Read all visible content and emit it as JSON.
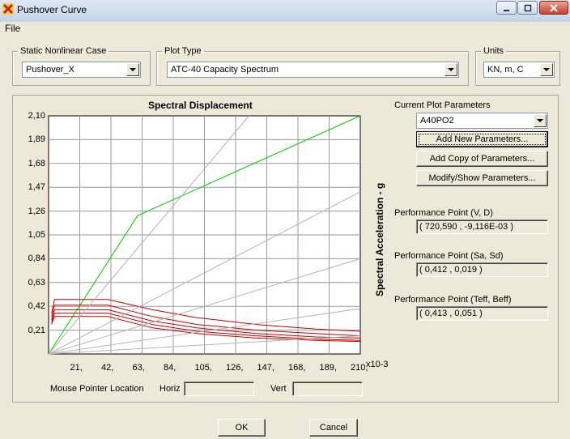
{
  "window": {
    "title": "Pushover Curve",
    "app_icon": "x-cross-icon",
    "buttons": {
      "minimize": "minimize-icon",
      "maximize": "maximize-icon",
      "close": "close-icon"
    }
  },
  "menu": {
    "file": "File"
  },
  "groups": {
    "case": {
      "label": "Static Nonlinear Case",
      "value": "Pushover_X"
    },
    "plot_type": {
      "label": "Plot Type",
      "value": "ATC-40 Capacity Spectrum"
    },
    "units": {
      "label": "Units",
      "value": "KN, m, C"
    }
  },
  "params": {
    "label": "Current Plot Parameters",
    "value": "A40PO2",
    "buttons": {
      "add_new": "Add New Parameters...",
      "add_copy": "Add Copy of Parameters...",
      "modify": "Modify/Show Parameters..."
    }
  },
  "performance": {
    "vd_label": "Performance Point (V, D)",
    "vd_value": "( 720,590 , -9,116E-03 )",
    "sasd_label": "Performance Point (Sa, Sd)",
    "sasd_value": "( 0,412 , 0,019 )",
    "teff_label": "Performance Point (Teff, Beff)",
    "teff_value": "( 0,413 , 0,051 )"
  },
  "mouse": {
    "label": "Mouse Pointer Location",
    "horiz_label": "Horiz",
    "horiz_value": "",
    "vert_label": "Vert",
    "vert_value": ""
  },
  "footer": {
    "ok": "OK",
    "cancel": "Cancel"
  },
  "chart_data": {
    "type": "line",
    "title": "Spectral Displacement",
    "ylabel": "Spectral Acceleration - g",
    "x_multiplier_label": "x10-3",
    "xlim": [
      0,
      210
    ],
    "ylim": [
      0,
      2.1
    ],
    "x_ticks": [
      "21,",
      "42,",
      "63,",
      "84,",
      "105,",
      "126,",
      "147,",
      "168,",
      "189,",
      "210,"
    ],
    "y_ticks": [
      "2,10",
      "1,89",
      "1,68",
      "1,47",
      "1,26",
      "1,05",
      "0,84",
      "0,63",
      "0,42",
      "0,21"
    ],
    "grid": true,
    "colors": {
      "capacity": "#00cc00",
      "demand": "#cc0000",
      "period": "#b4b4b4"
    },
    "series": [
      {
        "role": "capacity",
        "x": [
          0,
          60,
          210
        ],
        "y": [
          0,
          1.22,
          2.1
        ]
      },
      {
        "role": "demand",
        "x": [
          2,
          4,
          40,
          70,
          100,
          140,
          180,
          210
        ],
        "y": [
          0.36,
          0.48,
          0.48,
          0.39,
          0.32,
          0.26,
          0.22,
          0.2
        ]
      },
      {
        "role": "demand",
        "x": [
          2,
          4,
          40,
          70,
          100,
          140,
          180,
          210
        ],
        "y": [
          0.33,
          0.43,
          0.43,
          0.33,
          0.26,
          0.21,
          0.18,
          0.16
        ]
      },
      {
        "role": "demand",
        "x": [
          2,
          4,
          40,
          70,
          100,
          140,
          180,
          210
        ],
        "y": [
          0.3,
          0.39,
          0.39,
          0.29,
          0.23,
          0.18,
          0.15,
          0.14
        ]
      },
      {
        "role": "demand",
        "x": [
          2,
          4,
          40,
          70,
          100,
          140,
          180,
          210
        ],
        "y": [
          0.28,
          0.36,
          0.36,
          0.26,
          0.2,
          0.16,
          0.13,
          0.12
        ]
      },
      {
        "role": "demand",
        "x": [
          2,
          4,
          40,
          70,
          100,
          140,
          180,
          210
        ],
        "y": [
          0.26,
          0.33,
          0.33,
          0.23,
          0.18,
          0.14,
          0.12,
          0.11
        ]
      },
      {
        "role": "period",
        "x": [
          0,
          135
        ],
        "y": [
          0,
          2.1
        ]
      },
      {
        "role": "period",
        "x": [
          0,
          210
        ],
        "y": [
          0,
          1.43
        ]
      },
      {
        "role": "period",
        "x": [
          0,
          210
        ],
        "y": [
          0,
          0.84
        ]
      },
      {
        "role": "period",
        "x": [
          0,
          210
        ],
        "y": [
          0,
          0.4
        ]
      },
      {
        "role": "period",
        "x": [
          0,
          210
        ],
        "y": [
          0,
          0.16
        ]
      }
    ]
  }
}
